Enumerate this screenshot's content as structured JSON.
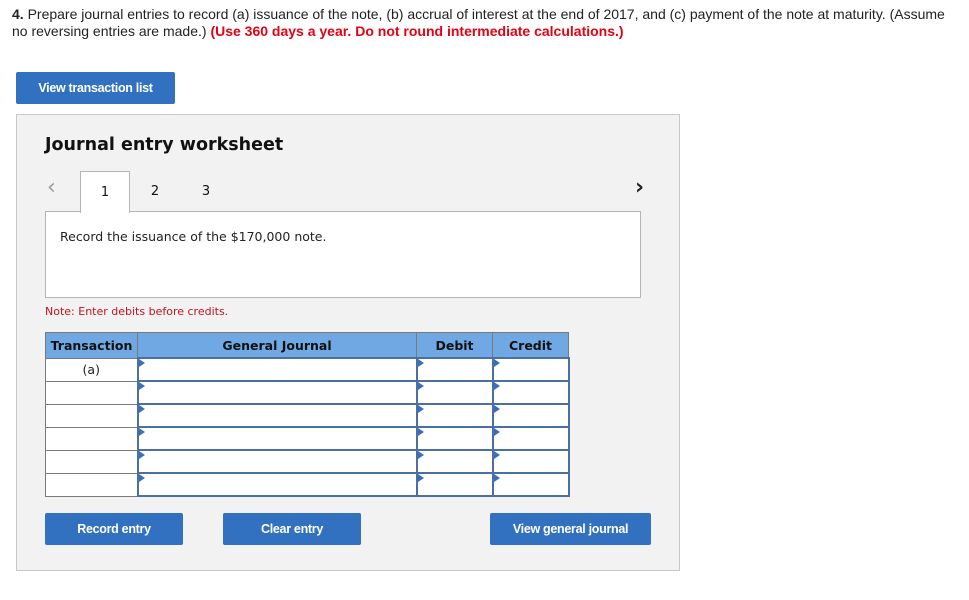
{
  "question": {
    "number": "4.",
    "text": "Prepare journal entries to record (a) issuance of the note, (b) accrual of interest at the end of 2017, and (c) payment of the note at maturity. (Assume no reversing entries are made.)",
    "emphasis": "(Use 360 days a year. Do not round intermediate calculations.)"
  },
  "buttons": {
    "view_transaction_list": "View transaction list",
    "record_entry": "Record entry",
    "clear_entry": "Clear entry",
    "view_general_journal": "View general journal"
  },
  "worksheet": {
    "title": "Journal entry worksheet",
    "nav_prev_icon": "‹",
    "nav_next_icon": "›",
    "tabs": [
      {
        "label": "1",
        "active": true
      },
      {
        "label": "2",
        "active": false
      },
      {
        "label": "3",
        "active": false
      }
    ],
    "description": "Record the issuance of the $170,000 note.",
    "note": "Note: Enter debits before credits."
  },
  "journal_table": {
    "headers": {
      "transaction": "Transaction",
      "general_journal": "General Journal",
      "debit": "Debit",
      "credit": "Credit"
    },
    "rows": [
      {
        "transaction": "(a)",
        "account": "",
        "debit": "",
        "credit": ""
      },
      {
        "transaction": "",
        "account": "",
        "debit": "",
        "credit": ""
      },
      {
        "transaction": "",
        "account": "",
        "debit": "",
        "credit": ""
      },
      {
        "transaction": "",
        "account": "",
        "debit": "",
        "credit": ""
      },
      {
        "transaction": "",
        "account": "",
        "debit": "",
        "credit": ""
      },
      {
        "transaction": "",
        "account": "",
        "debit": "",
        "credit": ""
      }
    ]
  },
  "colors": {
    "button_blue": "#3271c0",
    "header_blue": "#6fa8e3",
    "emphasis_red": "#e60012",
    "note_red": "#c1121f"
  }
}
